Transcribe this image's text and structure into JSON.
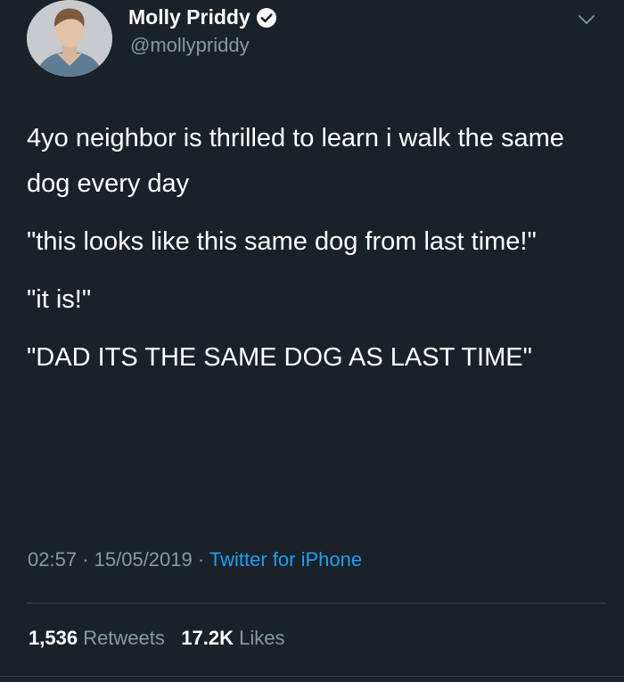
{
  "author": {
    "name": "Molly Priddy",
    "handle": "@mollypriddy",
    "verified": true
  },
  "tweet": {
    "paragraphs": [
      "4yo neighbor is thrilled to learn i walk the same dog every day",
      "\"this looks like this same dog from last time!\"",
      "\"it is!\"",
      "\"DAD ITS THE SAME DOG AS LAST TIME\""
    ],
    "time": "02:57",
    "date": "15/05/2019",
    "separator": "·",
    "source": "Twitter for iPhone"
  },
  "stats": {
    "retweets_count": "1,536",
    "retweets_label": "Retweets",
    "likes_count": "17.2K",
    "likes_label": "Likes"
  },
  "colors": {
    "background": "#1a2129",
    "secondary_text": "#8899a6",
    "link": "#1da1f2"
  }
}
